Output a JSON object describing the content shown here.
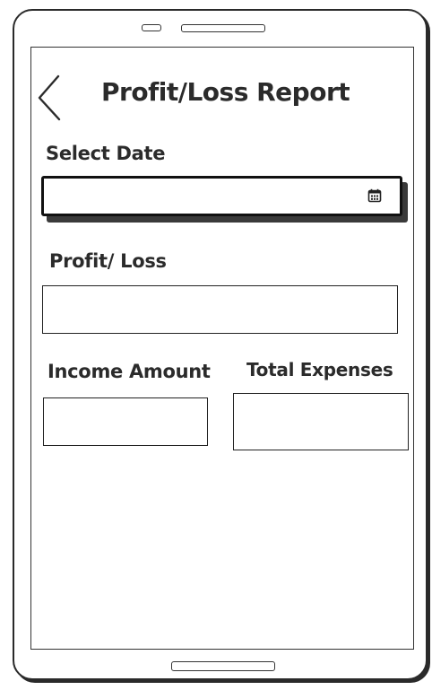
{
  "header": {
    "title": "Profit/Loss Report",
    "back_icon": "chevron-left-icon"
  },
  "form": {
    "date_label": "Select Date",
    "date_value": "",
    "date_icon": "calendar-icon",
    "profit_loss_label": "Profit/ Loss",
    "profit_loss_value": "",
    "income_label": "Income Amount",
    "income_value": "",
    "expenses_label": "Total Expenses",
    "expenses_value": ""
  }
}
